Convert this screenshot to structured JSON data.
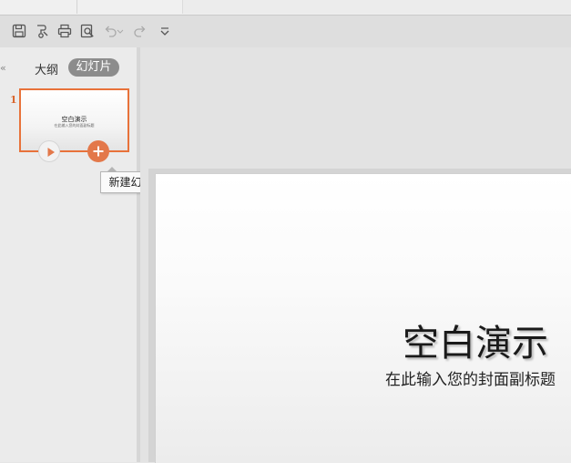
{
  "sidebar": {
    "collapse_glyph": "«",
    "tabs": [
      {
        "label": "大纲"
      },
      {
        "label": "幻灯片"
      }
    ],
    "slides": [
      {
        "number": "1",
        "title": "空白演示",
        "subtitle": "在此输入您的封面副标题"
      }
    ],
    "tooltip": "新建幻灯片"
  },
  "toolbar": {
    "icons": [
      "save-icon",
      "format-painter-icon",
      "print-icon",
      "print-preview-icon",
      "undo-icon",
      "redo-icon",
      "customize-dropdown-icon"
    ]
  },
  "slide": {
    "title": "空白演示",
    "subtitle": "在此输入您的封面副标题"
  },
  "colors": {
    "accent": "#e8723a",
    "add_button": "#e3784a"
  }
}
